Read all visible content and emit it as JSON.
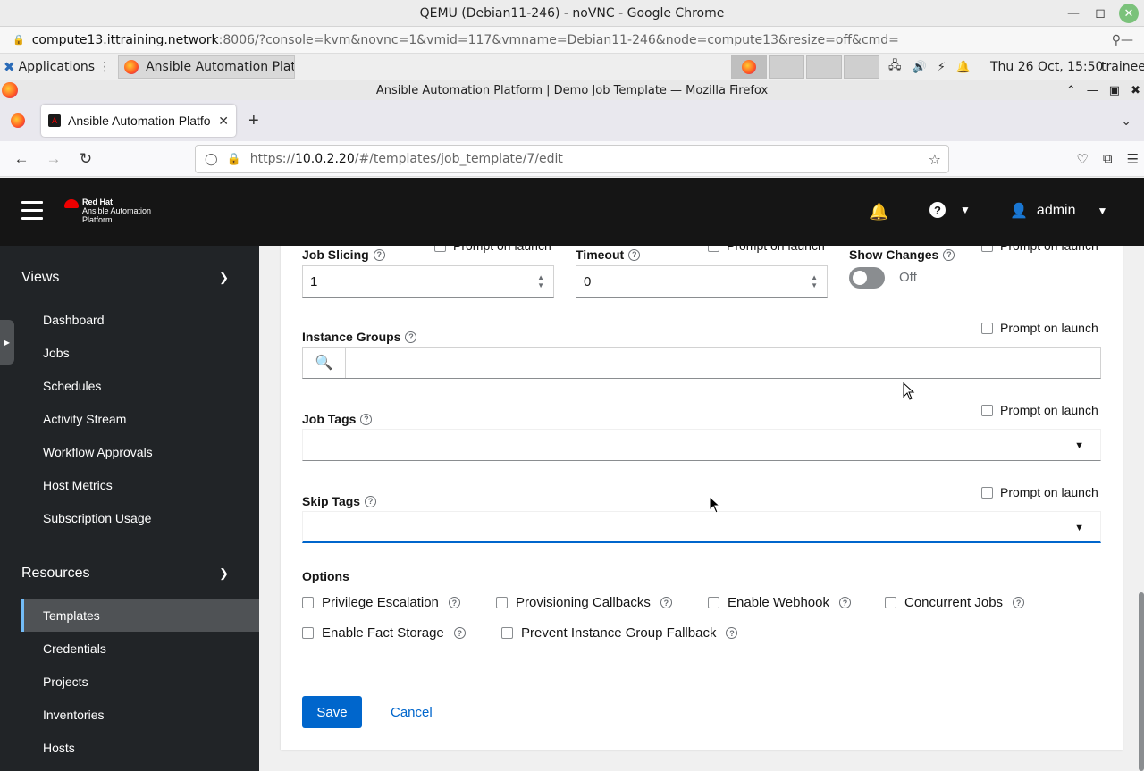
{
  "chrome": {
    "title": "QEMU (Debian11-246) - noVNC - Google Chrome",
    "url_host": "compute13.ittraining.network",
    "url_rest": ":8006/?console=kvm&novnc=1&vmid=117&vmname=Debian11-246&node=compute13&resize=off&cmd="
  },
  "taskbar": {
    "applications": "Applications",
    "task_label": "Ansible Automation Plat...",
    "clock": "Thu 26 Oct, 15:50",
    "user": "trainee"
  },
  "firefox": {
    "title": "Ansible Automation Platform | Demo Job Template — Mozilla Firefox",
    "tab_label": "Ansible Automation Platfo",
    "url_prefix": "https://",
    "url_host": "10.0.2.20",
    "url_path": "/#/templates/job_template/7/edit"
  },
  "masthead": {
    "brand_line1": "Red Hat",
    "brand_line2": "Ansible Automation",
    "brand_line3": "Platform",
    "user": "admin"
  },
  "sidebar": {
    "views_label": "Views",
    "views_items": [
      "Dashboard",
      "Jobs",
      "Schedules",
      "Activity Stream",
      "Workflow Approvals",
      "Host Metrics",
      "Subscription Usage"
    ],
    "resources_label": "Resources",
    "resources_items": [
      "Templates",
      "Credentials",
      "Projects",
      "Inventories",
      "Hosts"
    ],
    "active_item": "Templates"
  },
  "form": {
    "job_slicing": {
      "label": "Job Slicing",
      "value": "1",
      "prompt": "Prompt on launch"
    },
    "timeout": {
      "label": "Timeout",
      "value": "0",
      "prompt": "Prompt on launch"
    },
    "show_changes": {
      "label": "Show Changes",
      "state": "Off",
      "prompt": "Prompt on launch"
    },
    "instance_groups": {
      "label": "Instance Groups",
      "prompt": "Prompt on launch",
      "value": ""
    },
    "job_tags": {
      "label": "Job Tags",
      "prompt": "Prompt on launch",
      "value": ""
    },
    "skip_tags": {
      "label": "Skip Tags",
      "prompt": "Prompt on launch",
      "value": ""
    },
    "options_label": "Options",
    "options": [
      {
        "label": "Privilege Escalation",
        "checked": false
      },
      {
        "label": "Provisioning Callbacks",
        "checked": false
      },
      {
        "label": "Enable Webhook",
        "checked": false
      },
      {
        "label": "Concurrent Jobs",
        "checked": false
      },
      {
        "label": "Enable Fact Storage",
        "checked": false
      },
      {
        "label": "Prevent Instance Group Fallback",
        "checked": false
      }
    ],
    "save_label": "Save",
    "cancel_label": "Cancel"
  },
  "colors": {
    "primary": "#0066cc",
    "masthead": "#151515",
    "sidebar": "#212427",
    "active_nav": "#4f5255",
    "brand_red": "#ee0000"
  }
}
